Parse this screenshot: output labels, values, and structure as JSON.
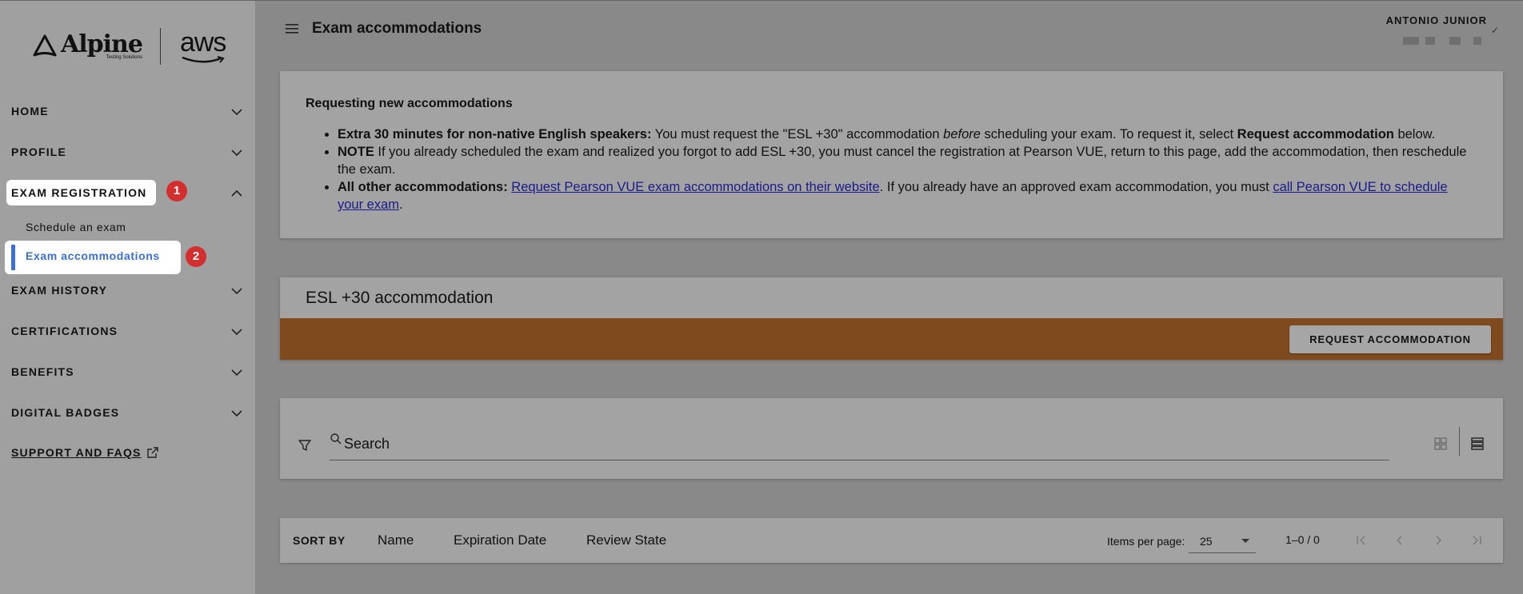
{
  "sidebar": {
    "logo_alpine": "Alpine",
    "logo_alpine_sub": "Testing Solutions",
    "logo_aws": "aws",
    "nav": [
      {
        "label": "HOME"
      },
      {
        "label": "PROFILE"
      },
      {
        "label": "EXAM REGISTRATION"
      },
      {
        "label": "EXAM HISTORY"
      },
      {
        "label": "CERTIFICATIONS"
      },
      {
        "label": "BENEFITS"
      },
      {
        "label": "DIGITAL BADGES"
      }
    ],
    "sub_items": [
      "Schedule an exam",
      "Exam accommodations"
    ],
    "support": "SUPPORT AND FAQS",
    "badge_1": "1",
    "badge_2": "2"
  },
  "header": {
    "title": "Exam accommodations",
    "user_name": "ANTONIO JUNIOR"
  },
  "info": {
    "title": "Requesting new accommodations",
    "b1_bold": "Extra 30 minutes for non-native English speakers:",
    "b1_text1": " You must request the \"ESL +30\" accommodation ",
    "b1_italic": "before",
    "b1_text2": " scheduling your exam. To request it, select ",
    "b1_bold2": "Request accommodation",
    "b1_text3": " below.",
    "b2_bold": "NOTE",
    "b2_text": " If you already scheduled the exam and realized you forgot to add ESL +30, you must cancel the registration at Pearson VUE, return to this page, add the accommodation, then reschedule the exam.",
    "b3_bold": "All other accommodations:",
    "b3_link1": "Request Pearson VUE exam accommodations on their website",
    "b3_text": ". If you already have an approved exam accommodation, you must ",
    "b3_link2": "call Pearson VUE to schedule your exam",
    "b3_end": "."
  },
  "esl": {
    "title": "ESL +30 accommodation",
    "button": "REQUEST ACCOMMODATION"
  },
  "search": {
    "placeholder": "Search"
  },
  "sort": {
    "label": "SORT BY",
    "options": [
      "Name",
      "Expiration Date",
      "Review State"
    ],
    "items_per_page_label": "Items per page:",
    "items_per_page": "25",
    "range": "1–0 / 0"
  },
  "colors": {
    "accent": "#3b6fd6",
    "badge": "#d32f2f",
    "esl_bar": "#7e4a1e"
  }
}
